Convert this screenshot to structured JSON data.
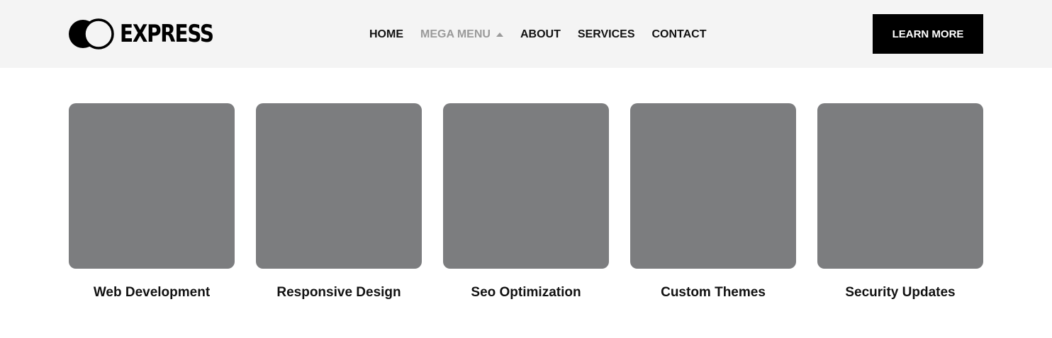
{
  "header": {
    "logo": {
      "text": "EXPRESS",
      "mark_icon": "twin-circles-logo-icon"
    },
    "nav": [
      {
        "label": "HOME",
        "active": false
      },
      {
        "label": "MEGA MENU",
        "active": true,
        "icon": "caret-up-icon"
      },
      {
        "label": "ABOUT",
        "active": false
      },
      {
        "label": "SERVICES",
        "active": false
      },
      {
        "label": "CONTACT",
        "active": false
      }
    ],
    "cta_label": "LEARN MORE"
  },
  "cards": [
    {
      "title": "Web Development"
    },
    {
      "title": "Responsive Design"
    },
    {
      "title": "Seo Optimization"
    },
    {
      "title": "Custom Themes"
    },
    {
      "title": "Security Updates"
    }
  ],
  "colors": {
    "header_background": "#f4f4f4",
    "active_nav": "#9a9a9a",
    "cta_background": "#000000",
    "card_placeholder": "#7c7d7f"
  }
}
